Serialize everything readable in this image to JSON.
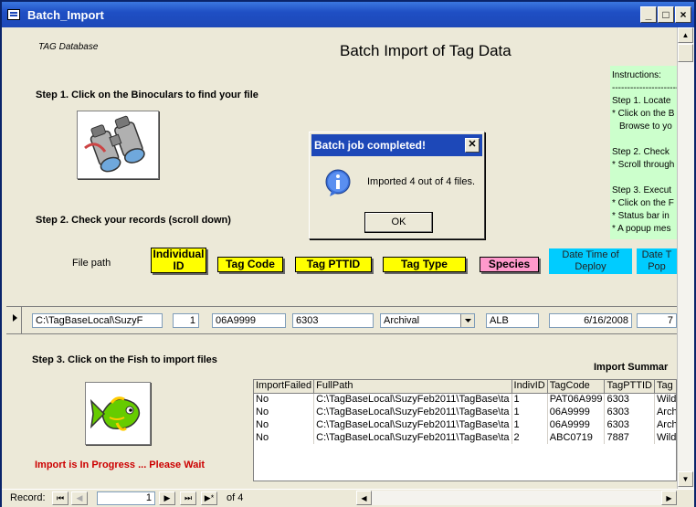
{
  "window": {
    "title": "Batch_Import",
    "controls": [
      "_",
      "□",
      "×"
    ]
  },
  "header": {
    "database_label": "TAG Database",
    "page_title": "Batch Import of Tag Data"
  },
  "step1": {
    "label": "Step 1. Click on the Binoculars to find your file"
  },
  "step2": {
    "label": "Step 2. Check your records (scroll down)"
  },
  "step3": {
    "label": "Step 3. Click on the Fish to import files"
  },
  "instructions": {
    "lines": [
      "Instructions:",
      "-------------------------",
      "Step 1. Locate",
      "* Click on the B",
      "  Browse to yo",
      "",
      "Step 2. Check",
      "* Scroll through",
      "",
      "Step 3. Execut",
      "* Click on the F",
      "* Status bar in",
      "* A popup mes"
    ]
  },
  "columns": {
    "file_path": "File path",
    "individual_id": "Individual ID",
    "tag_code": "Tag Code",
    "tag_pttid": "Tag PTTID",
    "tag_type": "Tag Type",
    "species": "Species",
    "date_time_deploy": "Date Time of Deploy",
    "date_time_pop": "Date T Pop"
  },
  "record": {
    "file_path": "C:\\TagBaseLocal\\SuzyF",
    "individual_id": "1",
    "tag_code": "06A9999",
    "tag_pttid": "6303",
    "tag_type": "Archival",
    "species": "ALB",
    "date_deploy": "6/16/2008",
    "date_pop": "7"
  },
  "dialog": {
    "title": "Batch job completed!",
    "message": "Imported 4 out of 4 files.",
    "ok_label": "OK"
  },
  "status": {
    "progress_text": "Import is In Progress ... Please Wait"
  },
  "import_summary": {
    "title": "Import Summar",
    "headers": [
      "ImportFailed",
      "FullPath",
      "IndivID",
      "TagCode",
      "TagPTTID",
      "Tag"
    ],
    "rows": [
      [
        "No",
        "C:\\TagBaseLocal\\SuzyFeb2011\\TagBase\\ta",
        "1",
        "PAT06A999",
        "6303",
        "Wild"
      ],
      [
        "No",
        "C:\\TagBaseLocal\\SuzyFeb2011\\TagBase\\ta",
        "1",
        "06A9999",
        "6303",
        "Arch"
      ],
      [
        "No",
        "C:\\TagBaseLocal\\SuzyFeb2011\\TagBase\\ta",
        "1",
        "06A9999",
        "6303",
        "Arch"
      ],
      [
        "No",
        "C:\\TagBaseLocal\\SuzyFeb2011\\TagBase\\ta",
        "2",
        "ABC0719",
        "7887",
        "Wild"
      ]
    ]
  },
  "navigation": {
    "record_label": "Record:",
    "current": "1",
    "of_label": "of",
    "total": "4"
  },
  "colors": {
    "title_bar": "#1d48b8",
    "yellow_header": "#ffff00",
    "pink_header": "#ff99cc",
    "blue_header": "#00ccff",
    "instructions_bg": "#ccffcc",
    "progress_text": "#cc0000"
  }
}
